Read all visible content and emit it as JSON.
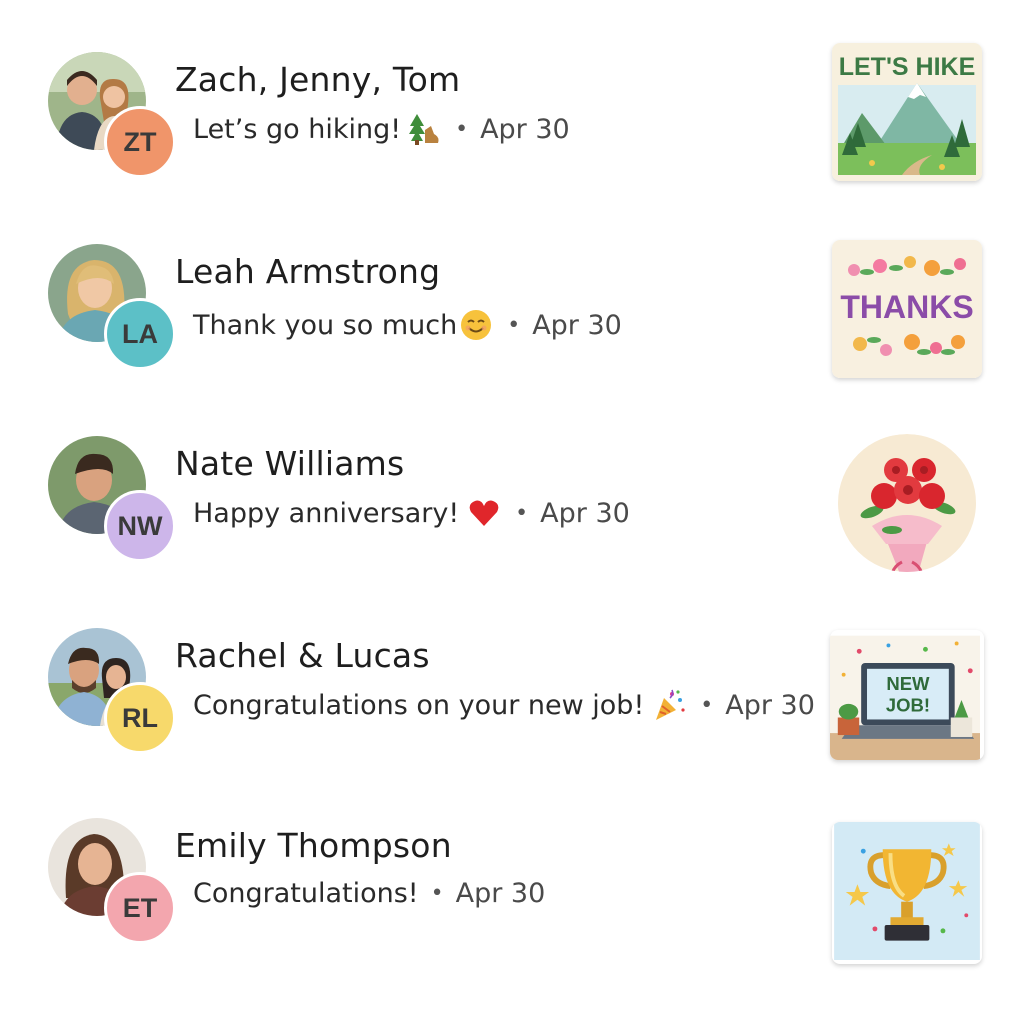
{
  "conversations": [
    {
      "name": "Zach, Jenny, Tom",
      "initials": "ZT",
      "badge_color": "#f0956a",
      "message": "Let’s go hiking!",
      "emoji": "evergreen-tree-and-boot-icon",
      "date": "Apr 30",
      "sticker": {
        "label": "LET'S HIKE",
        "icon": "mountain-landscape-icon"
      }
    },
    {
      "name": "Leah Armstrong",
      "initials": "LA",
      "badge_color": "#5cc0c7",
      "message": "Thank you so much",
      "emoji": "smiling-face-icon",
      "date": "Apr 30",
      "sticker": {
        "label": "THANKS",
        "icon": "flower-wreath-icon"
      }
    },
    {
      "name": "Nate Williams",
      "initials": "NW",
      "badge_color": "#cdb6ea",
      "message": "Happy anniversary!",
      "emoji": "red-heart-icon",
      "date": "Apr 30",
      "sticker": {
        "icon": "rose-bouquet-icon"
      }
    },
    {
      "name": "Rachel & Lucas",
      "initials": "RL",
      "badge_color": "#f7d96b",
      "message": "Congratulations on your new job!",
      "emoji": "party-popper-icon",
      "date": "Apr 30",
      "sticker": {
        "label_line1": "NEW",
        "label_line2": "JOB!",
        "icon": "laptop-icon"
      }
    },
    {
      "name": "Emily Thompson",
      "initials": "ET",
      "badge_color": "#f3a6ae",
      "message": "Congratulations!",
      "date": "Apr 30",
      "sticker": {
        "icon": "trophy-icon"
      }
    }
  ]
}
